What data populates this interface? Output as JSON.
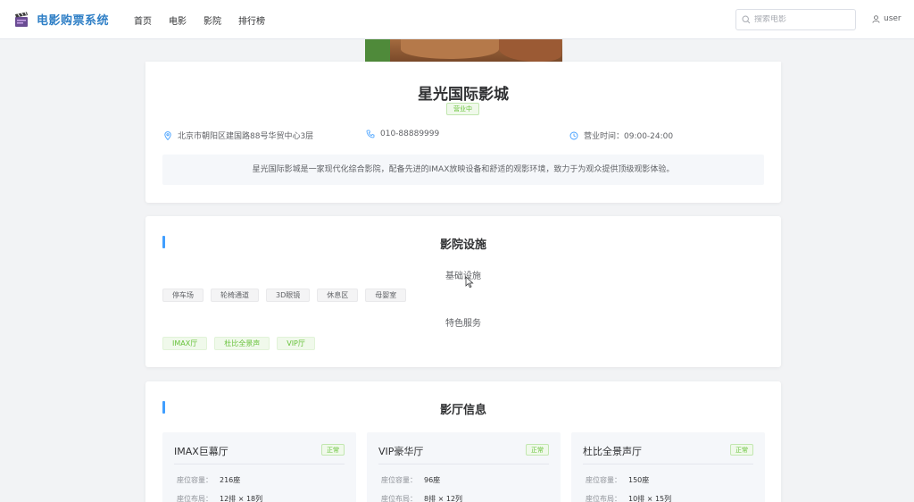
{
  "header": {
    "app_title": "电影购票系统",
    "nav": [
      "首页",
      "电影",
      "影院",
      "排行榜"
    ],
    "search_placeholder": "搜索电影",
    "username": "user"
  },
  "cinema": {
    "name": "星光国际影城",
    "status": "营业中",
    "address": "北京市朝阳区建国路88号华贸中心3层",
    "phone": "010-88889999",
    "hours": "营业时间：09:00-24:00",
    "description": "星光国际影城是一家现代化综合影院，配备先进的IMAX放映设备和舒适的观影环境，致力于为观众提供顶级观影体验。"
  },
  "facilities": {
    "title": "影院设施",
    "basic_title": "基础设施",
    "basic": [
      "停车场",
      "轮椅通道",
      "3D眼镜",
      "休息区",
      "母婴室"
    ],
    "special_title": "特色服务",
    "special": [
      "IMAX厅",
      "杜比全景声",
      "VIP厅"
    ]
  },
  "halls": {
    "title": "影厅信息",
    "capacity_label": "座位容量：",
    "layout_label": "座位布局：",
    "items": [
      {
        "name": "IMAX巨幕厅",
        "status": "正常",
        "capacity": "216座",
        "layout": "12排 × 18列"
      },
      {
        "name": "VIP豪华厅",
        "status": "正常",
        "capacity": "96座",
        "layout": "8排 × 12列"
      },
      {
        "name": "杜比全景声厅",
        "status": "正常",
        "capacity": "150座",
        "layout": "10排 × 15列"
      }
    ]
  },
  "colors": {
    "brand": "#2f7fc6",
    "accent": "#409eff",
    "success": "#67c23a"
  }
}
